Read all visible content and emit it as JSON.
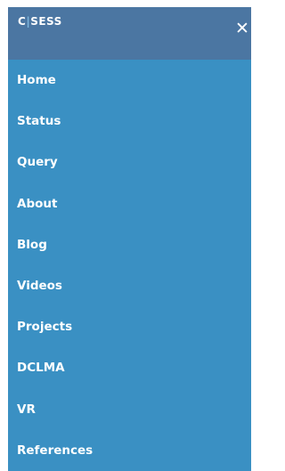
{
  "header": {
    "logo_text_a": "C",
    "logo_text_b": "SESS",
    "close_label": "✕"
  },
  "nav": {
    "items": [
      {
        "label": "Home"
      },
      {
        "label": "Status"
      },
      {
        "label": "Query"
      },
      {
        "label": "About"
      },
      {
        "label": "Blog"
      },
      {
        "label": "Videos"
      },
      {
        "label": "Projects"
      },
      {
        "label": "DCLMA"
      },
      {
        "label": "VR"
      },
      {
        "label": "References"
      }
    ]
  },
  "colors": {
    "header_bg": "#4b76a2",
    "menu_bg": "#3a90c3",
    "text": "#ffffff"
  }
}
